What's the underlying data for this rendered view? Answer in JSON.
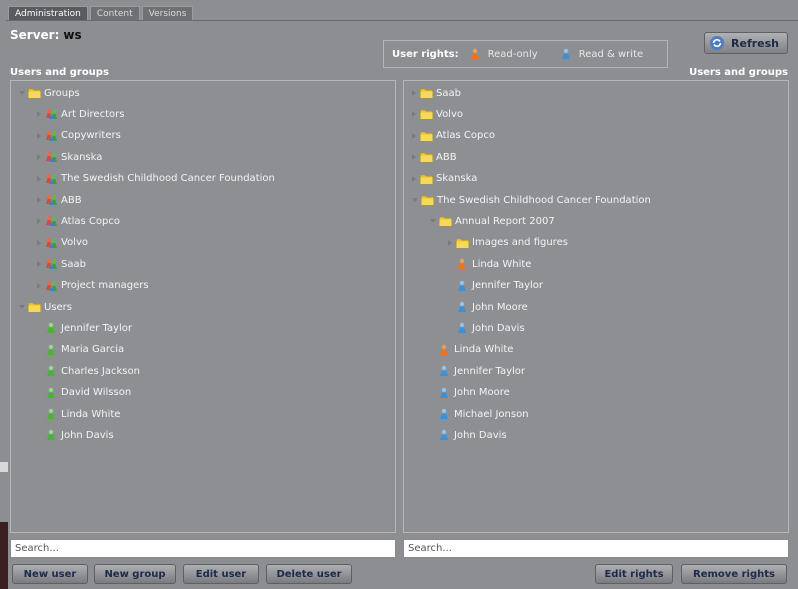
{
  "tabs": [
    {
      "label": "Administration",
      "active": true
    },
    {
      "label": "Content",
      "active": false
    },
    {
      "label": "Versions",
      "active": false
    }
  ],
  "server": {
    "label": "Server:",
    "value": "ws"
  },
  "user_rights": {
    "label": "User rights:",
    "read_only": {
      "label": "Read-only",
      "icon": "user-orange-icon",
      "color": "#e8732a"
    },
    "read_write": {
      "label": "Read & write",
      "icon": "user-blue-icon",
      "color": "#3f8fd6"
    }
  },
  "refresh_label": "Refresh",
  "left": {
    "title": "Users and groups",
    "search_placeholder": "Search...",
    "tree": [
      {
        "label": "Groups",
        "type": "folder",
        "level": 0,
        "expanded": true
      },
      {
        "label": "Art Directors",
        "type": "group",
        "level": 1
      },
      {
        "label": "Copywriters",
        "type": "group",
        "level": 1
      },
      {
        "label": "Skanska",
        "type": "group",
        "level": 1
      },
      {
        "label": "The Swedish Childhood Cancer Foundation",
        "type": "group",
        "level": 1
      },
      {
        "label": "ABB",
        "type": "group",
        "level": 1
      },
      {
        "label": "Atlas Copco",
        "type": "group",
        "level": 1
      },
      {
        "label": "Volvo",
        "type": "group",
        "level": 1
      },
      {
        "label": "Saab",
        "type": "group",
        "level": 1
      },
      {
        "label": "Project managers",
        "type": "group",
        "level": 1
      },
      {
        "label": "Users",
        "type": "folder",
        "level": 0,
        "expanded": true
      },
      {
        "label": "Jennifer Taylor",
        "type": "user-green",
        "level": 1
      },
      {
        "label": "Maria Garcia",
        "type": "user-green",
        "level": 1
      },
      {
        "label": "Charles Jackson",
        "type": "user-green",
        "level": 1
      },
      {
        "label": "David Wilsson",
        "type": "user-green",
        "level": 1
      },
      {
        "label": "Linda White",
        "type": "user-green",
        "level": 1
      },
      {
        "label": "John Davis",
        "type": "user-green",
        "level": 1
      }
    ],
    "buttons": [
      "New user",
      "New group",
      "Edit user",
      "Delete user"
    ]
  },
  "right": {
    "title": "Users and groups",
    "search_placeholder": "Search...",
    "tree": [
      {
        "label": "Saab",
        "type": "folder",
        "level": 0,
        "expanded": false
      },
      {
        "label": "Volvo",
        "type": "folder",
        "level": 0,
        "expanded": false
      },
      {
        "label": "Atlas Copco",
        "type": "folder",
        "level": 0,
        "expanded": false
      },
      {
        "label": "ABB",
        "type": "folder",
        "level": 0,
        "expanded": false
      },
      {
        "label": "Skanska",
        "type": "folder",
        "level": 0,
        "expanded": false
      },
      {
        "label": "The Swedish Childhood Cancer Foundation",
        "type": "folder",
        "level": 0,
        "expanded": true
      },
      {
        "label": "Annual Report 2007",
        "type": "folder",
        "level": 1,
        "expanded": true
      },
      {
        "label": "Images and figures",
        "type": "folder",
        "level": 2,
        "expanded": false
      },
      {
        "label": "Linda White",
        "type": "user-orange",
        "level": 2
      },
      {
        "label": "Jennifer Taylor",
        "type": "user-blue",
        "level": 2
      },
      {
        "label": "John Moore",
        "type": "user-blue",
        "level": 2
      },
      {
        "label": "John Davis",
        "type": "user-blue",
        "level": 2
      },
      {
        "label": "Linda White",
        "type": "user-orange",
        "level": 1
      },
      {
        "label": "Jennifer Taylor",
        "type": "user-blue",
        "level": 1
      },
      {
        "label": "John Moore",
        "type": "user-blue",
        "level": 1
      },
      {
        "label": "Michael Jonson",
        "type": "user-blue",
        "level": 1
      },
      {
        "label": "John Davis",
        "type": "user-blue",
        "level": 1
      }
    ],
    "buttons": [
      "Edit rights",
      "Remove rights"
    ]
  }
}
